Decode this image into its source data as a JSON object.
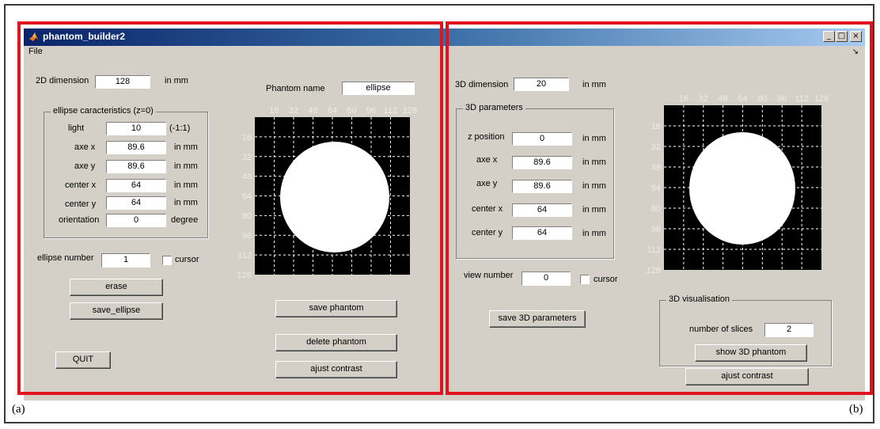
{
  "window": {
    "title": "phantom_builder2",
    "menu_file": "File",
    "btn_min": "_",
    "btn_max": "□",
    "btn_close": "×",
    "dock_glyph": "↘"
  },
  "panel_a": {
    "dim_label": "2D dimension",
    "dim_value": "128",
    "dim_unit": "in mm",
    "group_title": "ellipse caracteristics (z=0)",
    "params": [
      {
        "label": "light",
        "value": "10",
        "unit": "(-1:1)"
      },
      {
        "label": "axe x",
        "value": "89.6",
        "unit": "in mm"
      },
      {
        "label": "axe y",
        "value": "89.6",
        "unit": "in mm"
      },
      {
        "label": "center x",
        "value": "64",
        "unit": "in mm"
      },
      {
        "label": "center y",
        "value": "64",
        "unit": "in mm"
      },
      {
        "label": "orientation",
        "value": "0",
        "unit": "degree"
      }
    ],
    "ellipse_number_label": "ellipse number",
    "ellipse_number_value": "1",
    "cursor_label": "cursor",
    "erase": "erase",
    "save_ellipse": "save_ellipse",
    "quit": "QUIT",
    "phantom_name_label": "Phantom name",
    "phantom_name_value": "ellipse",
    "save_phantom": "save phantom",
    "delete_phantom": "delete phantom",
    "ajust_contrast": "ajust contrast",
    "x_ticks": [
      "16",
      "32",
      "48",
      "64",
      "80",
      "96",
      "112",
      "128"
    ],
    "y_ticks": [
      "16",
      "32",
      "48",
      "64",
      "80",
      "96",
      "112",
      "128"
    ]
  },
  "panel_b": {
    "dim_label": "3D dimension",
    "dim_value": "20",
    "dim_unit": "in mm",
    "group_title": "3D parameters",
    "params": [
      {
        "label": "z position",
        "value": "0",
        "unit": "in mm"
      },
      {
        "label": "axe x",
        "value": "89.6",
        "unit": "in mm"
      },
      {
        "label": "axe y",
        "value": "89.6",
        "unit": "in mm"
      },
      {
        "label": "center x",
        "value": "64",
        "unit": "in mm"
      },
      {
        "label": "center y",
        "value": "64",
        "unit": "in mm"
      }
    ],
    "view_number_label": "view number",
    "view_number_value": "0",
    "cursor_label": "cursor",
    "save_3d": "save 3D parameters",
    "vis_title": "3D visualisation",
    "slices_label": "number of slices",
    "slices_value": "2",
    "show_3d": "show 3D phantom",
    "ajust_contrast": "ajust contrast",
    "x_ticks": [
      "16",
      "32",
      "48",
      "64",
      "80",
      "96",
      "112",
      "128"
    ],
    "y_ticks": [
      "16",
      "32",
      "48",
      "64",
      "80",
      "96",
      "112",
      "128"
    ]
  },
  "captions": {
    "a": "(a)",
    "b": "(b)"
  }
}
